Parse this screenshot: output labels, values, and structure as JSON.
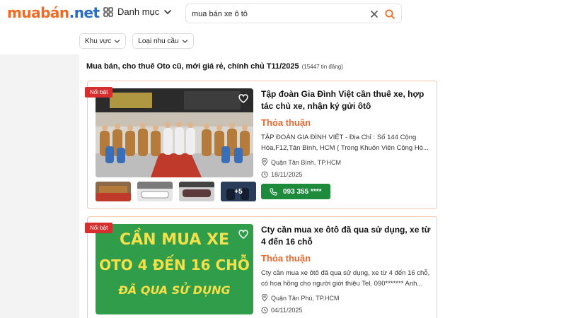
{
  "header": {
    "logo_brand": "muabán",
    "logo_tld": ".net",
    "category_label": "Danh mục",
    "search_value": "mua bán xe ô tô"
  },
  "filters": [
    {
      "label": "Khu vực"
    },
    {
      "label": "Loại nhu cầu"
    }
  ],
  "page": {
    "heading": "Mua bán, cho thuê Oto cũ, mới giá rẻ, chính chủ T11/2025",
    "count": "(15447 tin đăng)"
  },
  "listings": [
    {
      "badge": "Nổi bật",
      "title": "Tập đoàn Gia Đình Việt cần thuê xe, hợp tác chủ xe, nhận ký gửi ôtô",
      "price": "Thỏa thuận",
      "description": "TẬP ĐOÀN GIA ĐÌNH VIỆT - Địa Chỉ : Số 144 Cộng Hòa,F12,Tân Bình, HCM ( Trong Khuôn Viên Cộng Hò...",
      "location": "Quận Tân Bình, TP.HCM",
      "date": "18/11/2025",
      "phone": "093 355 ****",
      "more_photos": "+5"
    },
    {
      "badge": "Nổi bật",
      "title": "Cty cần mua xe ôtô đã qua sử dụng, xe từ 4 đến 16 chỗ",
      "price": "Thỏa thuận",
      "description": "Cty cần mua xe ôtô đã qua sử dụng, xe từ 4 đến 16 chỗ, có hoa hồng cho người giới thiệu Tel. 090******* Anh...",
      "location": "Quận Tân Phú, TP.HCM",
      "date": "04/11/2025",
      "image_text": [
        "CẦN MUA XE",
        "OTO 4 ĐẾN 16 CHỖ",
        "ĐÃ QUA SỬ DỤNG"
      ]
    }
  ],
  "colors": {
    "accent": "#e8672a",
    "badge": "#d62e2e",
    "call_button": "#1e8a3c",
    "card_border": "#f3c9b4"
  }
}
